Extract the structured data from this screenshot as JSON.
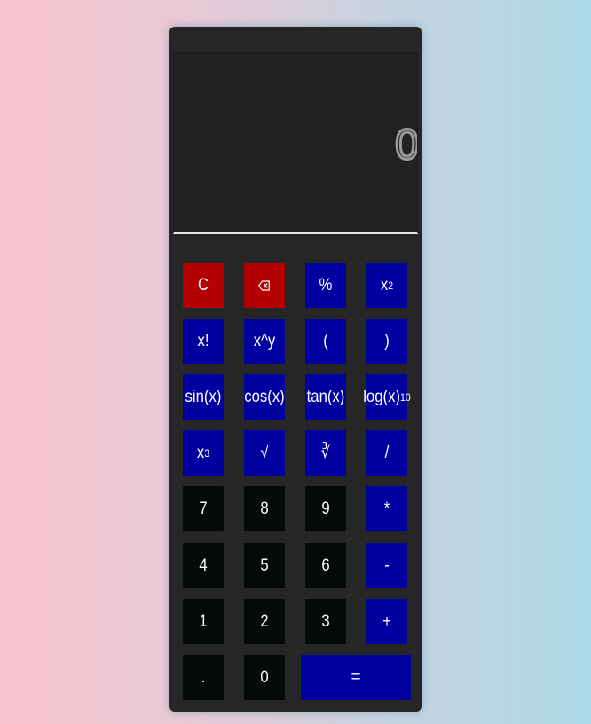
{
  "display": {
    "value": "0"
  },
  "keys": {
    "clear": "C",
    "percent": "%",
    "square_base": "x",
    "square_exp": "2",
    "factorial": "x!",
    "power": "x^y",
    "open_paren": "(",
    "close_paren": ")",
    "sin": "sin(x)",
    "cos": "cos(x)",
    "tan": "tan(x)",
    "log_main": "log(x)",
    "log_sub": "10",
    "cube_base": "x",
    "cube_exp": "3",
    "sqrt": "√",
    "cbrt": "∛",
    "divide": "/",
    "seven": "7",
    "eight": "8",
    "nine": "9",
    "multiply": "*",
    "four": "4",
    "five": "5",
    "six": "6",
    "subtract": "-",
    "one": "1",
    "two": "2",
    "three": "3",
    "add": "+",
    "decimal": ".",
    "zero": "0",
    "equals": "="
  },
  "icons": {
    "backspace": "backspace-icon"
  },
  "colors": {
    "danger": "#b30000",
    "operator": "#0000a0",
    "number": "#040a05",
    "body": "#262626"
  }
}
